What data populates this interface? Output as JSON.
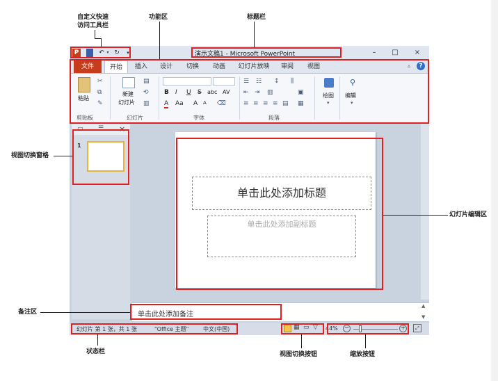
{
  "callouts": {
    "qat": "自定义快速\n访问工具栏",
    "qat_line1": "自定义快速",
    "qat_line2": "访问工具栏",
    "ribbon": "功能区",
    "titlebar": "标题栏",
    "slide_pane": "视图切换窗格",
    "slide_edit": "幻灯片编辑区",
    "notes": "备注区",
    "statusbar": "状态栏",
    "view_buttons": "视图切换按钮",
    "zoom_buttons": "缩放按钮"
  },
  "window": {
    "title": "演示文稿1 - Microsoft PowerPoint",
    "app_icon": "P",
    "controls": {
      "minimize": "–",
      "maximize": "□",
      "close": "×"
    }
  },
  "tabs": [
    "文件",
    "开始",
    "插入",
    "设计",
    "切换",
    "动画",
    "幻灯片放映",
    "审阅",
    "视图"
  ],
  "ribbon": {
    "paste": "粘贴",
    "new_slide_line1": "新建",
    "new_slide_line2": "幻灯片",
    "draw": "绘图",
    "edit": "编辑",
    "groups": [
      "剪贴板",
      "幻灯片",
      "字体",
      "段落"
    ],
    "font_buttons": [
      "B",
      "I",
      "U",
      "S",
      "abc",
      "AV",
      "A",
      "Aa",
      "A",
      "A"
    ]
  },
  "slide_pane": {
    "thumb_number": "1"
  },
  "slide": {
    "title_placeholder": "单击此处添加标题",
    "subtitle_placeholder": "单击此处添加副标题"
  },
  "notes": {
    "placeholder": "单击此处添加备注"
  },
  "statusbar": {
    "slide_info": "幻灯片 第 1 张，共 1 张",
    "theme": "\"Office 主题\"",
    "language": "中文(中国)",
    "zoom": "44%",
    "zoom_minus": "−",
    "zoom_plus": "+"
  }
}
